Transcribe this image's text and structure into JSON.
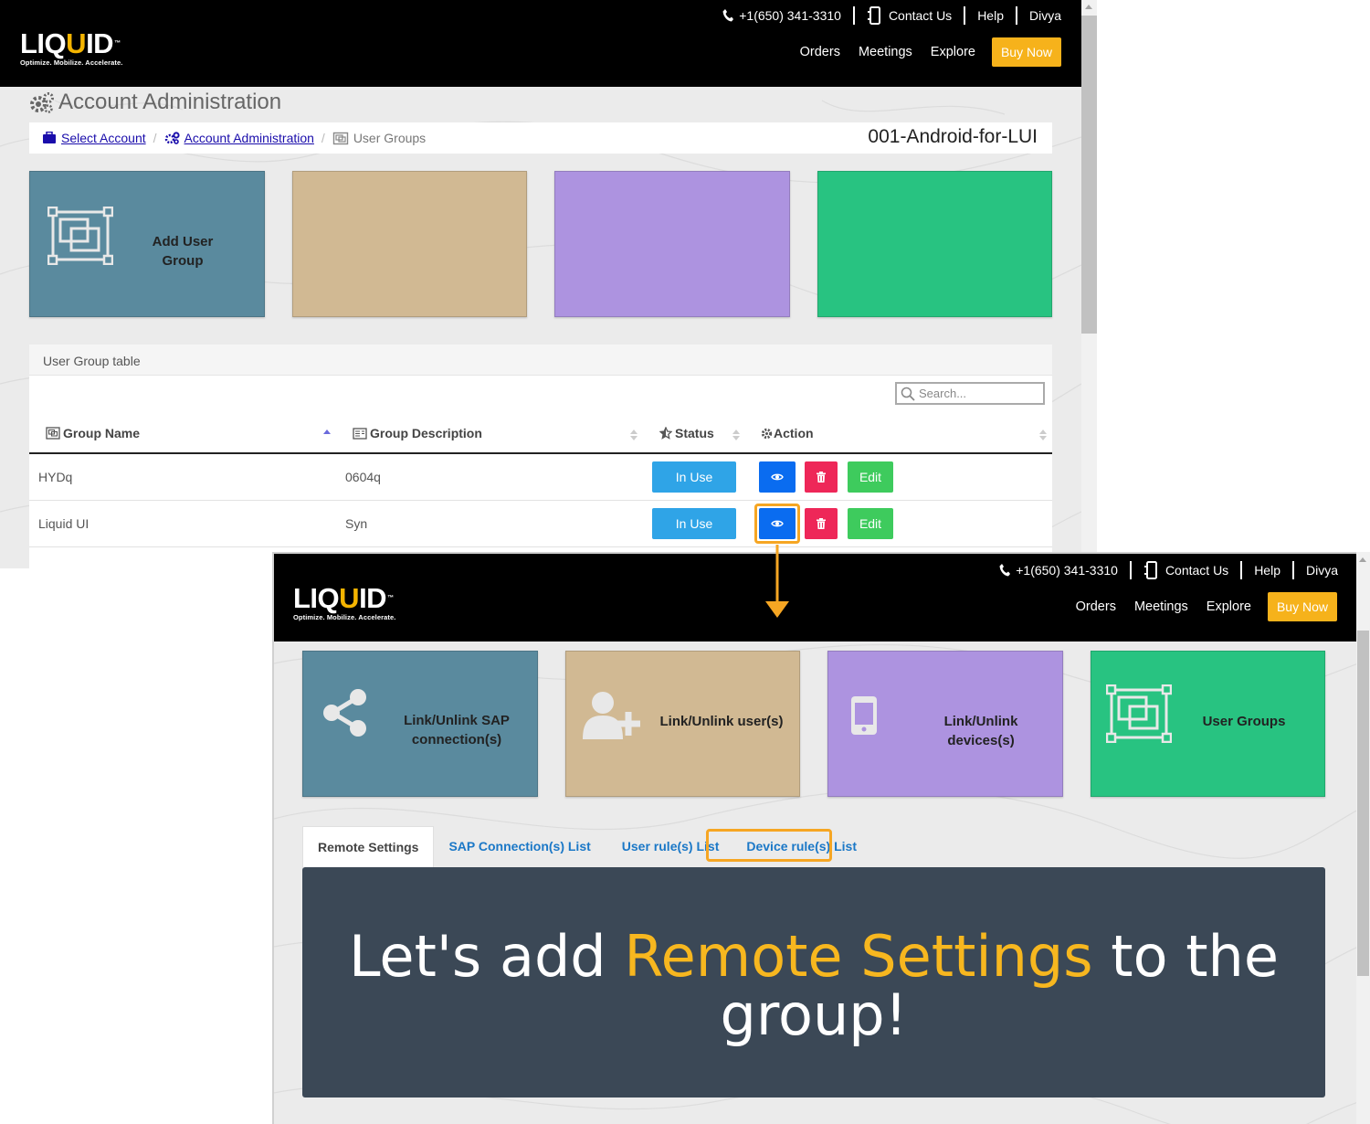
{
  "header": {
    "logo_text": "LIQUID",
    "logo_tagline": "Optimize. Mobilize. Accelerate.",
    "phone": "+1(650) 341-3310",
    "contact": "Contact Us",
    "help": "Help",
    "user": "Divya",
    "nav": [
      "Orders",
      "Meetings",
      "Explore"
    ],
    "buy_now": "Buy Now"
  },
  "screen1": {
    "page_title": "Account Administration",
    "breadcrumb": {
      "select_account": "Select Account",
      "account_admin": "Account Administration",
      "current": "User Groups"
    },
    "account_name": "001-Android-for-LUI",
    "tiles": [
      {
        "label": "Add User Group",
        "color": "#5a8a9e"
      },
      {
        "label": "",
        "color": "#d1b993"
      },
      {
        "label": "",
        "color": "#ad93e0"
      },
      {
        "label": "",
        "color": "#28c381"
      }
    ],
    "table": {
      "title": "User Group table",
      "search_placeholder": "Search...",
      "columns": [
        "Group Name",
        "Group Description",
        "Status",
        "Action"
      ],
      "rows": [
        {
          "name": "HYDq",
          "description": "0604q",
          "status": "In Use",
          "edit": "Edit"
        },
        {
          "name": "Liquid UI",
          "description": "Syn",
          "status": "In Use",
          "edit": "Edit"
        }
      ]
    }
  },
  "screen2": {
    "tiles": [
      {
        "label": "Link/Unlink SAP connection(s)",
        "icon": "share-icon",
        "color": "#5a8a9e"
      },
      {
        "label": "Link/Unlink user(s)",
        "icon": "user-plus-icon",
        "color": "#d1b993"
      },
      {
        "label": "Link/Unlink devices(s)",
        "icon": "mobile-icon",
        "color": "#ad93e0"
      },
      {
        "label": "User Groups",
        "icon": "group-icon",
        "color": "#28c381"
      }
    ],
    "tabs": [
      "Remote Settings",
      "SAP Connection(s) List",
      "User rule(s) List",
      "Device rule(s) List"
    ],
    "banner": {
      "pre": "Let's add ",
      "highlight": "Remote Settings",
      "post": " to the group!"
    }
  },
  "colors": {
    "accent": "#f6a623",
    "header_bg": "#000000",
    "buy_now": "#f6b21b",
    "banner_bg": "#3b4856",
    "banner_highlight": "#f7b71f"
  }
}
